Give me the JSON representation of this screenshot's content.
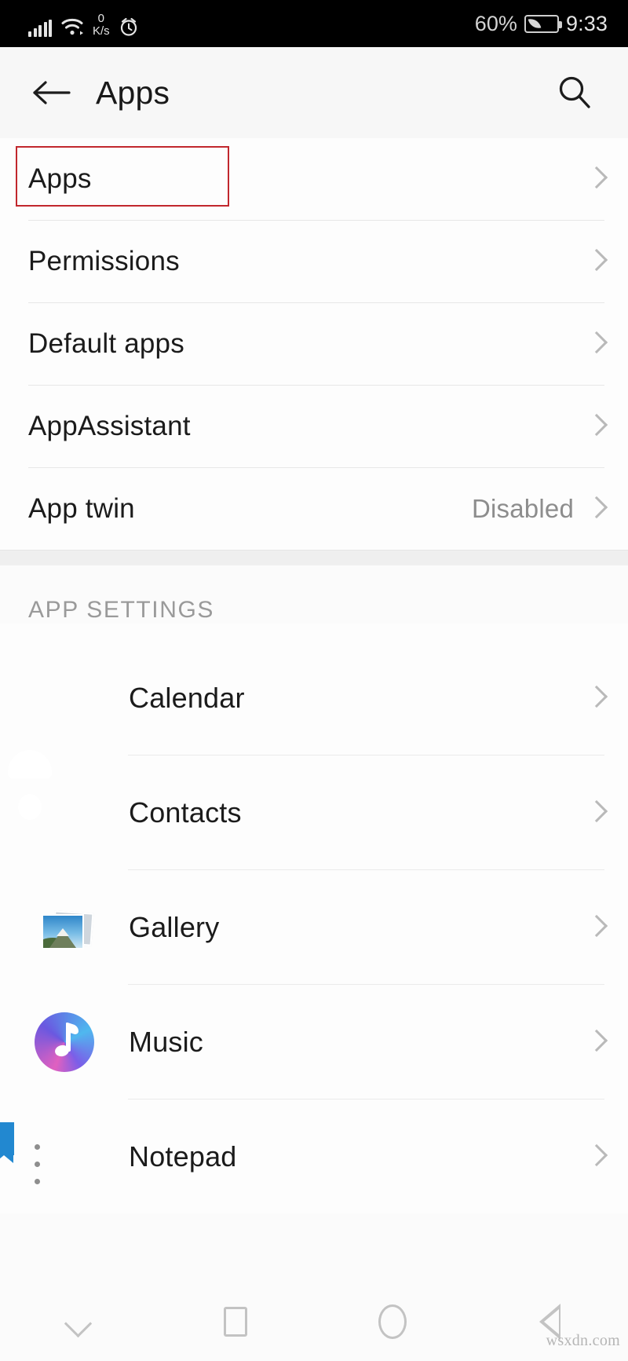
{
  "status_bar": {
    "signal_icon": "cellular-signal-icon",
    "wifi_icon": "wifi-icon",
    "network_speed_value": "0",
    "network_speed_unit": "K/s",
    "alarm_icon": "alarm-clock-icon",
    "battery_percent": "60%",
    "battery_icon": "battery-power-saving-icon",
    "time": "9:33"
  },
  "header": {
    "back_icon": "back-arrow-icon",
    "title": "Apps",
    "search_icon": "search-icon"
  },
  "settings_group": {
    "rows": [
      {
        "label": "Apps",
        "value": "",
        "highlighted": true
      },
      {
        "label": "Permissions",
        "value": "",
        "highlighted": false
      },
      {
        "label": "Default apps",
        "value": "",
        "highlighted": false
      },
      {
        "label": "AppAssistant",
        "value": "",
        "highlighted": false
      },
      {
        "label": "App twin",
        "value": "Disabled",
        "highlighted": false
      }
    ]
  },
  "app_settings": {
    "section_title": "APP SETTINGS",
    "apps": [
      {
        "label": "Calendar",
        "icon": "calendar-app-icon"
      },
      {
        "label": "Contacts",
        "icon": "contacts-app-icon"
      },
      {
        "label": "Gallery",
        "icon": "gallery-app-icon"
      },
      {
        "label": "Music",
        "icon": "music-app-icon"
      },
      {
        "label": "Notepad",
        "icon": "notepad-app-icon"
      }
    ]
  },
  "nav_bar": {
    "hide_icon": "chevron-down-icon",
    "recents_icon": "square-recents-icon",
    "home_icon": "circle-home-icon",
    "back_icon": "triangle-back-icon"
  },
  "watermark": "wsxdn.com",
  "colors": {
    "highlight_box": "#c1272d",
    "status_bar_bg": "#000000",
    "header_bg": "#f7f7f7",
    "calendar_red": "#c0393f",
    "contacts_teal": "#27aecd",
    "notepad_blue": "#2288d0"
  }
}
